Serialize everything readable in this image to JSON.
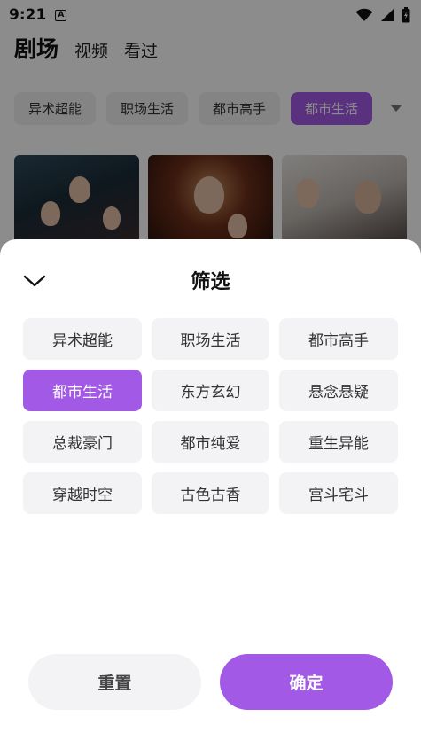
{
  "status": {
    "time": "9:21",
    "notification_badge": "A"
  },
  "top_tabs": [
    {
      "label": "剧场",
      "active": true
    },
    {
      "label": "视频",
      "active": false
    },
    {
      "label": "看过",
      "active": false
    }
  ],
  "bg_chips": [
    {
      "label": "异术超能",
      "active": false
    },
    {
      "label": "职场生活",
      "active": false
    },
    {
      "label": "都市高手",
      "active": false
    },
    {
      "label": "都市生活",
      "active": true
    }
  ],
  "sheet": {
    "title": "筛选",
    "options": [
      {
        "label": "异术超能",
        "selected": false
      },
      {
        "label": "职场生活",
        "selected": false
      },
      {
        "label": "都市高手",
        "selected": false
      },
      {
        "label": "都市生活",
        "selected": true
      },
      {
        "label": "东方玄幻",
        "selected": false
      },
      {
        "label": "悬念悬疑",
        "selected": false
      },
      {
        "label": "总裁豪门",
        "selected": false
      },
      {
        "label": "都市纯爱",
        "selected": false
      },
      {
        "label": "重生异能",
        "selected": false
      },
      {
        "label": "穿越时空",
        "selected": false
      },
      {
        "label": "古色古香",
        "selected": false
      },
      {
        "label": "宫斗宅斗",
        "selected": false
      }
    ],
    "reset_label": "重置",
    "confirm_label": "确定"
  },
  "colors": {
    "accent": "#a259e6",
    "chip_bg": "#f3f3f5",
    "overlay": "rgba(0,0,0,0.45)"
  },
  "icons": {
    "collapse": "chevron-down-icon",
    "wifi": "wifi-icon",
    "signal": "signal-icon",
    "battery": "battery-icon"
  }
}
